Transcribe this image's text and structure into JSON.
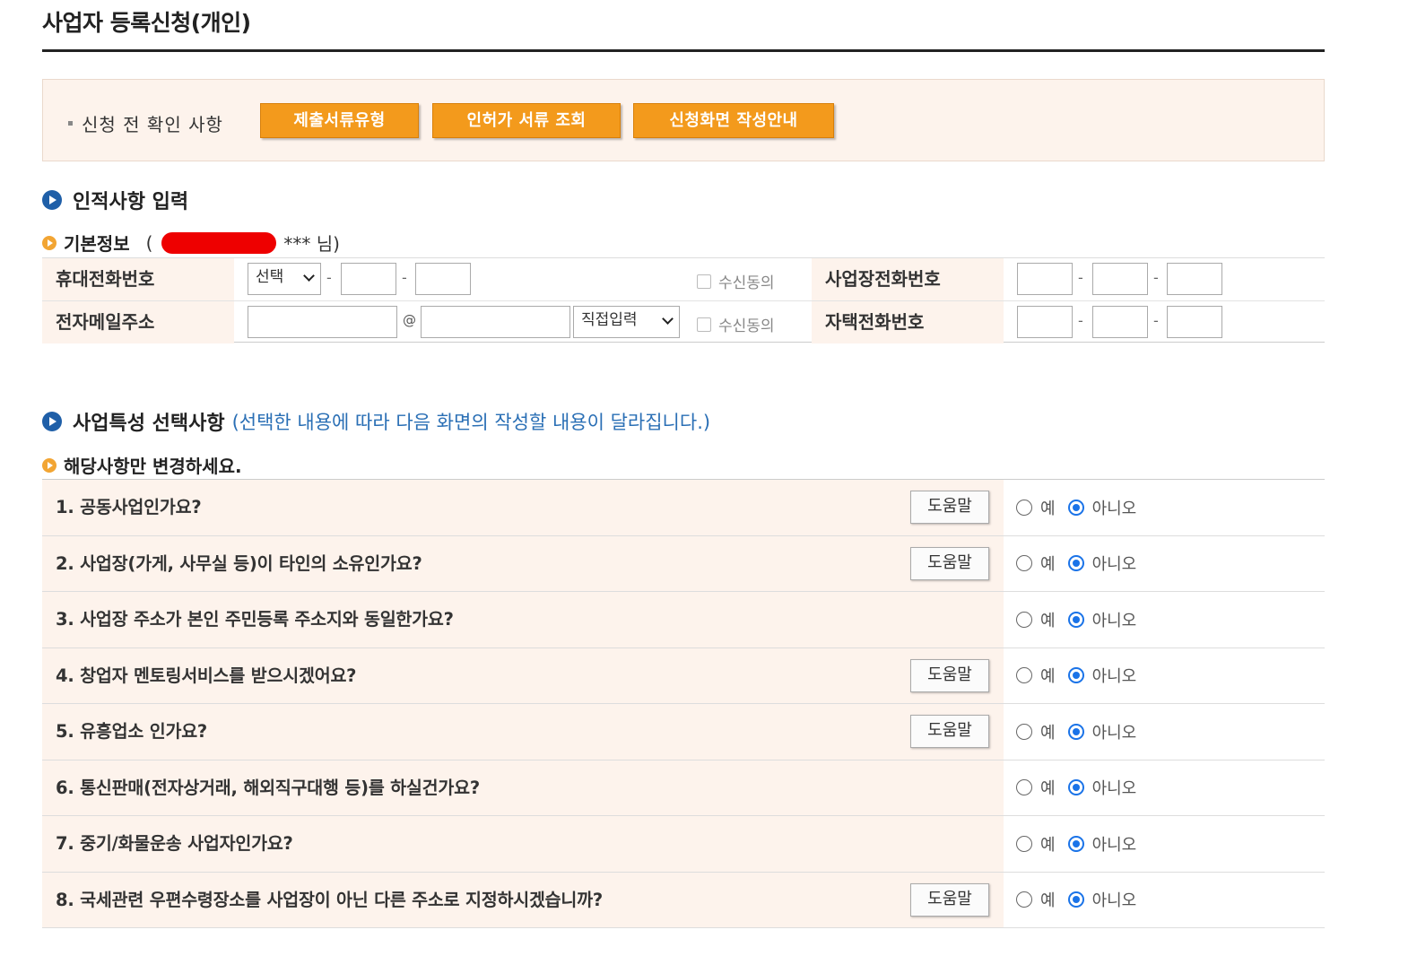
{
  "page": {
    "title": "사업자 등록신청(개인)"
  },
  "precheck": {
    "label": "신청 전 확인 사항",
    "buttons": [
      "제출서류유형",
      "인허가 서류 조회",
      "신청화면 작성안내"
    ]
  },
  "personal": {
    "section_title": "인적사항 입력",
    "basic_info": {
      "label": "기본정보",
      "open_paren": "(",
      "masked_suffix": "*** 님)"
    },
    "mobile": {
      "label": "휴대전화번호",
      "select_value": "선택",
      "consent": "수신동의"
    },
    "email": {
      "label": "전자메일주소",
      "at": "@",
      "domain_select": "직접입력",
      "consent": "수신동의"
    },
    "work_phone": {
      "label": "사업장전화번호"
    },
    "home_phone": {
      "label": "자택전화번호"
    },
    "dash": "-"
  },
  "business": {
    "section_title": "사업특성 선택사항",
    "section_note": "(선택한 내용에 따라 다음 화면의 작성할 내용이 달라집니다.)",
    "sub_label": "해당사항만 변경하세요.",
    "help_label": "도움말",
    "yes_label": "예",
    "no_label": "아니오",
    "questions": [
      {
        "text": "1. 공동사업인가요?",
        "has_help": true,
        "answer": "아니오"
      },
      {
        "text": "2. 사업장(가게, 사무실 등)이 타인의 소유인가요?",
        "has_help": true,
        "answer": "아니오"
      },
      {
        "text": "3. 사업장 주소가 본인 주민등록 주소지와 동일한가요?",
        "has_help": false,
        "answer": "아니오"
      },
      {
        "text": "4. 창업자 멘토링서비스를 받으시겠어요?",
        "has_help": true,
        "answer": "아니오"
      },
      {
        "text": "5. 유흥업소 인가요?",
        "has_help": true,
        "answer": "아니오"
      },
      {
        "text": "6. 통신판매(전자상거래, 해외직구대행 등)를 하실건가요?",
        "has_help": false,
        "answer": "아니오"
      },
      {
        "text": "7. 중기/화물운송 사업자인가요?",
        "has_help": false,
        "answer": "아니오"
      },
      {
        "text": "8. 국세관련 우편수령장소를 사업장이 아닌 다른 주소로 지정하시겠습니까?",
        "has_help": true,
        "answer": "아니오"
      }
    ]
  },
  "colors": {
    "accent_orange": "#f39a1c",
    "panel_bg": "#fdf3ec",
    "section_blue": "#1f5fa8",
    "note_blue": "#2a6fb5",
    "radio_blue": "#1a73e8",
    "redaction": "#ee0000"
  }
}
